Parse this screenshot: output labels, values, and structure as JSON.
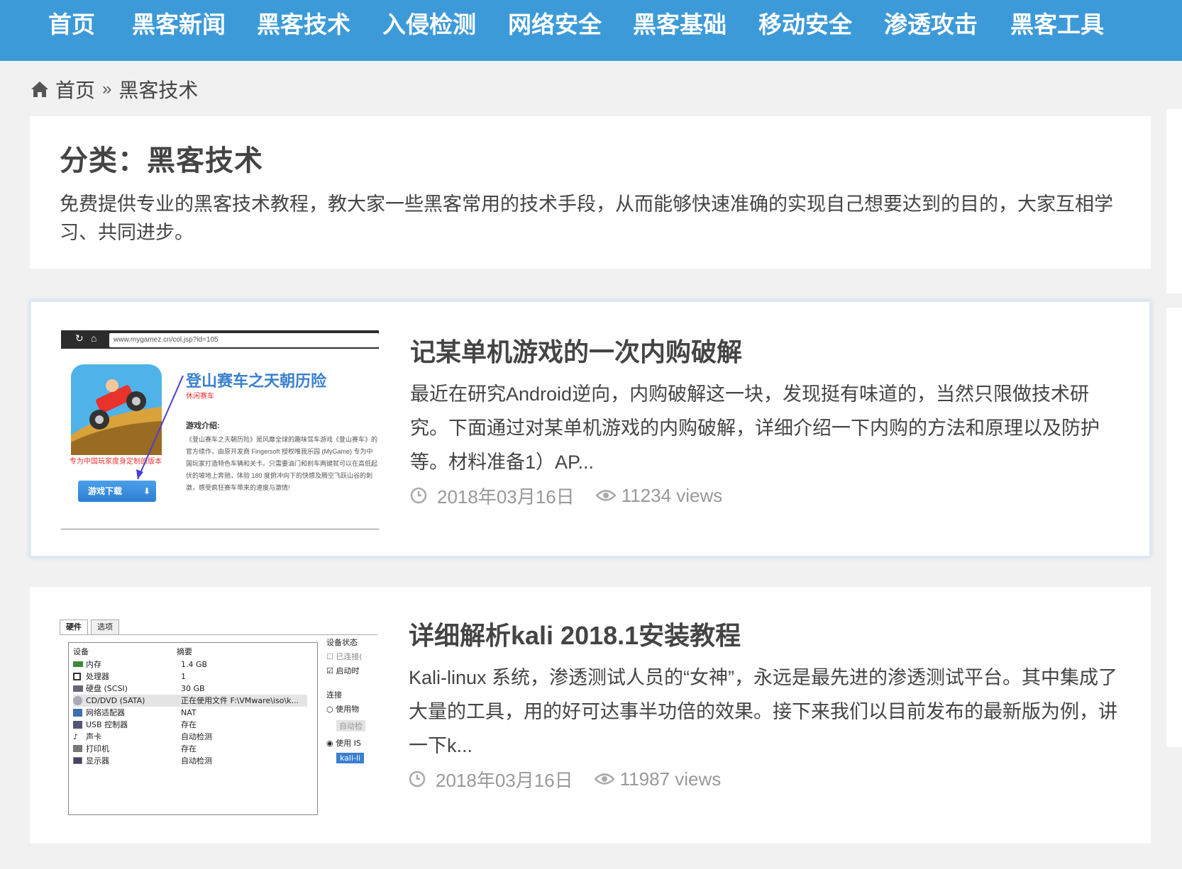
{
  "nav": {
    "items": [
      "首页",
      "黑客新闻",
      "黑客技术",
      "入侵检测",
      "网络安全",
      "黑客基础",
      "移动安全",
      "渗透攻击",
      "黑客工具"
    ]
  },
  "breadcrumb": {
    "home": "首页",
    "separator": "»",
    "current": "黑客技术"
  },
  "category": {
    "title": "分类：黑客技术",
    "description": "免费提供专业的黑客技术教程，教大家一些黑客常用的技术手段，从而能够快速准确的实现自己想要达到的目的，大家互相学习、共同进步。"
  },
  "articles": [
    {
      "title": "记某单机游戏的一次内购破解",
      "excerpt": "最近在研究Android逆向，内购破解这一块，发现挺有味道的，当然只限做技术研究。下面通过对某单机游戏的内购破解，详细介绍一下内购的方法和原理以及防护等。材料准备1）AP...",
      "date": "2018年03月16日",
      "views": "11234 views",
      "thumb": {
        "url": "www.mygamez.cn/col.jsp?id=105",
        "game_title": "登山赛车之天朝历险",
        "game_sub": "休闲赛车",
        "intro_heading": "游戏介绍:",
        "intro_text": "《登山赛车之天朝历险》是风靡全球的趣味驾车游戏《登山赛车》的官方续作，由原开发商 Fingersoft 授权唯我乐园 (MyGame) 专为中国玩家打造特色车辆和关卡。只需要油门和刹车两键就可以在高低起伏的坡地上奔驰，体验 180 度俯冲向下的快感及腾空飞跃山谷的刺激，感受疯狂赛车带来的速度与激情!",
        "promo": "专为中国玩家度身定制的版本",
        "download_button": "游戏下载"
      }
    },
    {
      "title": "详细解析kali 2018.1安装教程",
      "excerpt": "Kali-linux 系统，渗透测试人员的“女神”，永远是最先进的渗透测试平台。其中集成了大量的工具，用的好可达事半功倍的效果。接下来我们以目前发布的最新版为例，讲一下k...",
      "date": "2018年03月16日",
      "views": "11987 views",
      "thumb": {
        "tabs": [
          "硬件",
          "选项"
        ],
        "col_device": "设备",
        "col_summary": "摘要",
        "rows": [
          {
            "device": "内存",
            "summary": "1.4 GB"
          },
          {
            "device": "处理器",
            "summary": "1"
          },
          {
            "device": "硬盘 (SCSI)",
            "summary": "30 GB"
          },
          {
            "device": "CD/DVD (SATA)",
            "summary": "正在使用文件 F:\\VMware\\iso\\k..."
          },
          {
            "device": "网络适配器",
            "summary": "NAT"
          },
          {
            "device": "USB 控制器",
            "summary": "存在"
          },
          {
            "device": "声卡",
            "summary": "自动检测"
          },
          {
            "device": "打印机",
            "summary": "存在"
          },
          {
            "device": "显示器",
            "summary": "自动检测"
          }
        ],
        "side_status": "设备状态",
        "side_connected": "已连接(",
        "side_autoconnect": "启动时",
        "side_connection": "连接",
        "side_physical": "使用物",
        "side_auto": "自动检",
        "side_iso": "使用 IS",
        "side_kali": "kali-li"
      }
    }
  ],
  "colors": {
    "nav_bg": "#3d9ad8",
    "page_bg": "#f1f1f1",
    "text": "#444444",
    "meta": "#999999"
  }
}
